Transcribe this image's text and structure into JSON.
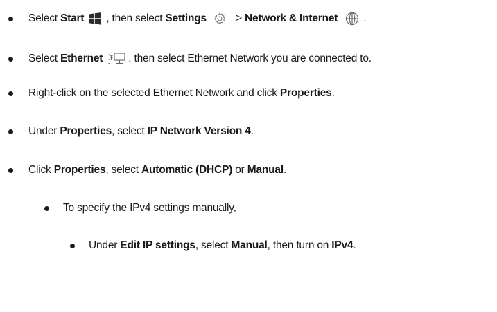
{
  "steps": [
    {
      "p1": "Select ",
      "b1": "Start",
      "icon1": "windows-logo-icon",
      "p2": ", then select ",
      "b2": "Settings",
      "icon2": "gear-icon",
      "p3": " > ",
      "b3": "Network & Internet",
      "icon3": "globe-icon",
      "p4": "."
    },
    {
      "p1": "Select ",
      "b1": "Ethernet",
      "icon1": "ethernet-network-icon",
      "p2": ", then select Ethernet Network you are connected to."
    },
    {
      "p1": "Right-click on the selected Ethernet Network and click ",
      "b1": "Properties",
      "p2": "."
    },
    {
      "p1": "Under ",
      "b1": "Properties",
      "p2": ", select ",
      "b2": "IP Network Version 4",
      "p3": "."
    },
    {
      "p1": "Click ",
      "b1": "Properties",
      "p2": ", select ",
      "b2": "Automatic (DHCP)",
      "p3": " or ",
      "b3": "Manual",
      "p4": "."
    },
    {
      "p1": "To specify the IPv4 settings manually,"
    },
    {
      "p1": "Under ",
      "b1": "Edit IP settings",
      "p2": ", select ",
      "b2": "Manual",
      "p3": ", then turn on ",
      "b3": "IPv4",
      "p4": "."
    }
  ],
  "colors": {
    "text": "#1a1a1a",
    "icon": "#555555"
  }
}
